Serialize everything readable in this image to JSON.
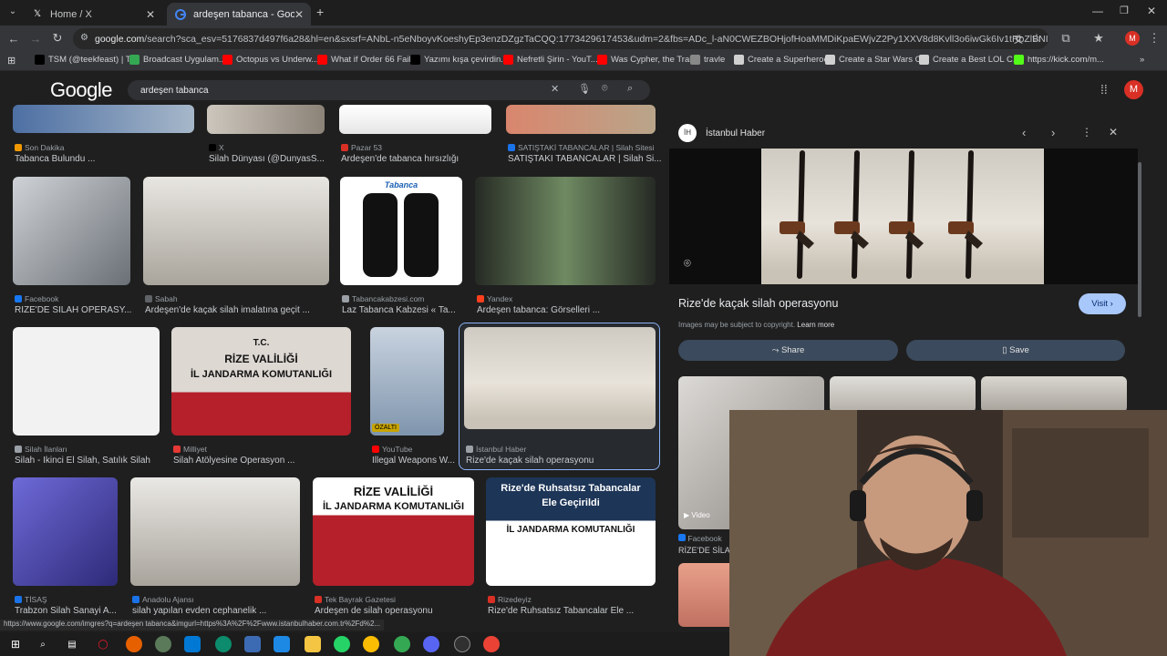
{
  "browser": {
    "tabs": [
      {
        "label": "Home / X",
        "icon": "x-logo-icon"
      },
      {
        "label": "ardeşen tabanca - Google Search",
        "icon": "google-icon"
      }
    ],
    "url_host": "google.com",
    "url_rest": "/search?sca_esv=5176837d497f6a28&hl=en&sxsrf=ANbL-n5eNboyvKoeshyEp3enzDZgzTaCQQ:1773429617453&udm=2&fbs=ADc_l-aN0CWEZBOHjofHoaMMDiKpaEWjvZ2Py1XXV8d8Kvll3o6iwGk6Iv1tRbZlBNIVs-6UIUc6UR65u...",
    "avatar_letter": "M"
  },
  "bookmarks": [
    {
      "label": "TSM (@teekfeast) | T...",
      "icon": "x-logo-icon",
      "color": "#000000"
    },
    {
      "label": "Broadcast Uygulam...",
      "icon": "leaf-icon",
      "color": "#34a853"
    },
    {
      "label": "Octopus vs Underw...",
      "icon": "youtube-icon",
      "color": "#ff0000"
    },
    {
      "label": "What if Order 66 Fail...",
      "icon": "youtube-icon",
      "color": "#ff0000"
    },
    {
      "label": "Yazımı kışa çevirdin...",
      "icon": "tiktok-icon",
      "color": "#000000"
    },
    {
      "label": "Nefretli Şirin - YouT...",
      "icon": "youtube-icon",
      "color": "#ff0000"
    },
    {
      "label": "Was Cypher, the Trai...",
      "icon": "youtube-icon",
      "color": "#ff0000"
    },
    {
      "label": "travle",
      "icon": "globe-icon",
      "color": "#888888"
    },
    {
      "label": "Create a Superheroe...",
      "icon": "doc-icon",
      "color": "#d0d0d0"
    },
    {
      "label": "Create a Star Wars C...",
      "icon": "doc-icon",
      "color": "#d0d0d0"
    },
    {
      "label": "Create a Best LOL C...",
      "icon": "doc-icon",
      "color": "#d0d0d0"
    },
    {
      "label": "https://kick.com/m...",
      "icon": "kick-icon",
      "color": "#53fc18"
    }
  ],
  "google": {
    "logo": "Google",
    "query": "ardeşen tabanca"
  },
  "results": [
    {
      "source": "Son Dakika",
      "title": "Tabanca Bulundu ...",
      "color": "#f29900"
    },
    {
      "source": "X",
      "title": "Silah Dünyası (@DunyasS...",
      "color": "#000000"
    },
    {
      "source": "Pazar 53",
      "title": "Ardeşen'de tabanca hırsızlığı",
      "color": "#d93025"
    },
    {
      "source": "SATIŞTAKİ TABANCALAR | Silah Sitesi",
      "title": "SATIŞTAKİ TABANCALAR | Silah Si...",
      "color": "#1a73e8"
    },
    {
      "source": "Facebook",
      "title": "RİZE'DE SİLAH OPERASY...",
      "color": "#1877f2"
    },
    {
      "source": "Sabah",
      "title": "Ardeşen'de kaçak silah imalatına geçit ...",
      "color": "#5f6368"
    },
    {
      "source": "Tabancakabzesi.com",
      "title": "Laz Tabanca Kabzesi « Ta...",
      "color": "#9aa0a6"
    },
    {
      "source": "Yandex",
      "title": "Ardeşen tabanca: Görselleri ...",
      "color": "#fc3f1d"
    },
    {
      "source": "Silah İlanları",
      "title": "Silah - İkinci El Silah, Satılık Silah",
      "color": "#9aa0a6"
    },
    {
      "source": "Milliyet",
      "title": "Silah Atölyesine Operasyon ...",
      "color": "#e53935"
    },
    {
      "source": "YouTube",
      "title": "Illegal Weapons W...",
      "color": "#ff0000",
      "badge": "ÖZALTI"
    },
    {
      "source": "İstanbul Haber",
      "title": "Rize'de kaçak silah operasyonu",
      "color": "#9aa0a6"
    },
    {
      "source": "TİSAŞ",
      "title": "Trabzon Silah Sanayi A...",
      "color": "#1a73e8"
    },
    {
      "source": "Anadolu Ajansı",
      "title": "silah yapılan evden cephanelik ...",
      "color": "#1a73e8"
    },
    {
      "source": "Tek Bayrak Gazetesi",
      "title": "Ardeşen de silah operasyonu",
      "color": "#d93025"
    },
    {
      "source": "Rizedeyiz",
      "title": "Rize'de Ruhsatsız Tabancalar Ele ...",
      "color": "#d93025"
    }
  ],
  "image_texts": {
    "tc": "T.C.",
    "rize_valiligi": "RİZE VALİLİĞİ",
    "il_jandarma": "İL JANDARMA KOMUTANLIĞI",
    "ruhsatsiz_1": "Rize'de Ruhsatsız Tabancalar",
    "ruhsatsiz_2": "Ele Geçirildi",
    "tabanca_logo": "Tabanca"
  },
  "panel": {
    "source": "İstanbul Haber",
    "source_initials": "İH",
    "title": "Rize'de kaçak silah operasyonu",
    "visit_label": "Visit",
    "copyright": "Images may be subject to copyright.",
    "learn_more": "Learn more",
    "share_label": "Share",
    "save_label": "Save",
    "related_video_label": "Video",
    "related_source": "Facebook",
    "related_title": "RİZE'DE SİLAH"
  },
  "status_url": "https://www.google.com/imgres?q=ardeşen tabanca&imgurl=https%3A%2F%2Fwww.istanbulhaber.com.tr%2Fd%2..."
}
